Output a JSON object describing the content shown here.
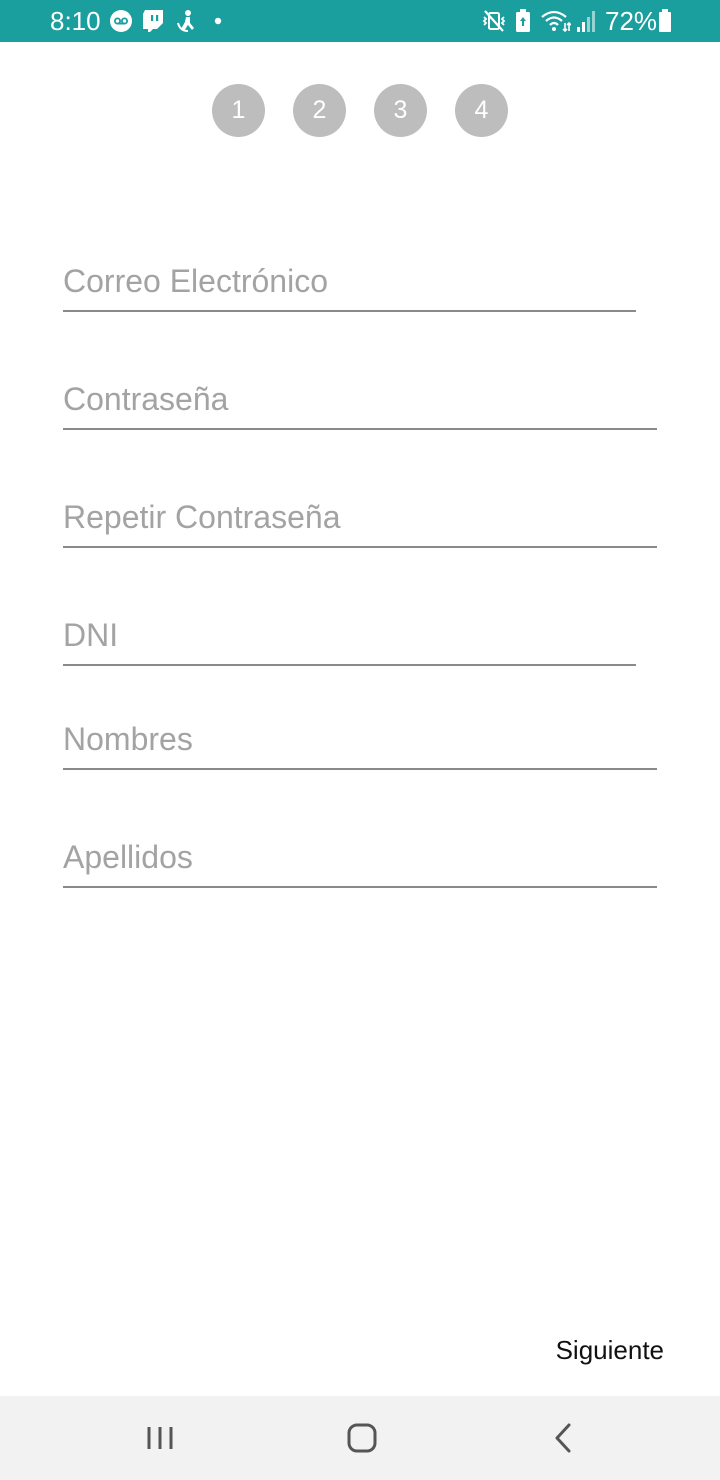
{
  "status_bar": {
    "time": "8:10",
    "battery_percent": "72%",
    "background_color": "#1a9e9e",
    "icons_left": [
      "voicemail-icon",
      "twitch-icon",
      "accessibility-icon",
      "dot-icon"
    ],
    "icons_right": [
      "mute-vibrate-icon",
      "battery-saver-icon",
      "wifi-icon",
      "signal-icon",
      "battery-icon"
    ]
  },
  "steps": [
    {
      "label": "1"
    },
    {
      "label": "2"
    },
    {
      "label": "3"
    },
    {
      "label": "4"
    }
  ],
  "form": {
    "fields": [
      {
        "placeholder": "Correo Electrónico",
        "value": ""
      },
      {
        "placeholder": "Contraseña",
        "value": ""
      },
      {
        "placeholder": "Repetir Contraseña",
        "value": ""
      },
      {
        "placeholder": "DNI",
        "value": ""
      },
      {
        "placeholder": "Nombres",
        "value": ""
      },
      {
        "placeholder": "Apellidos",
        "value": ""
      }
    ]
  },
  "actions": {
    "next_label": "Siguiente"
  },
  "nav_bar": {
    "buttons": [
      "recent-apps-icon",
      "home-icon",
      "back-icon"
    ]
  }
}
